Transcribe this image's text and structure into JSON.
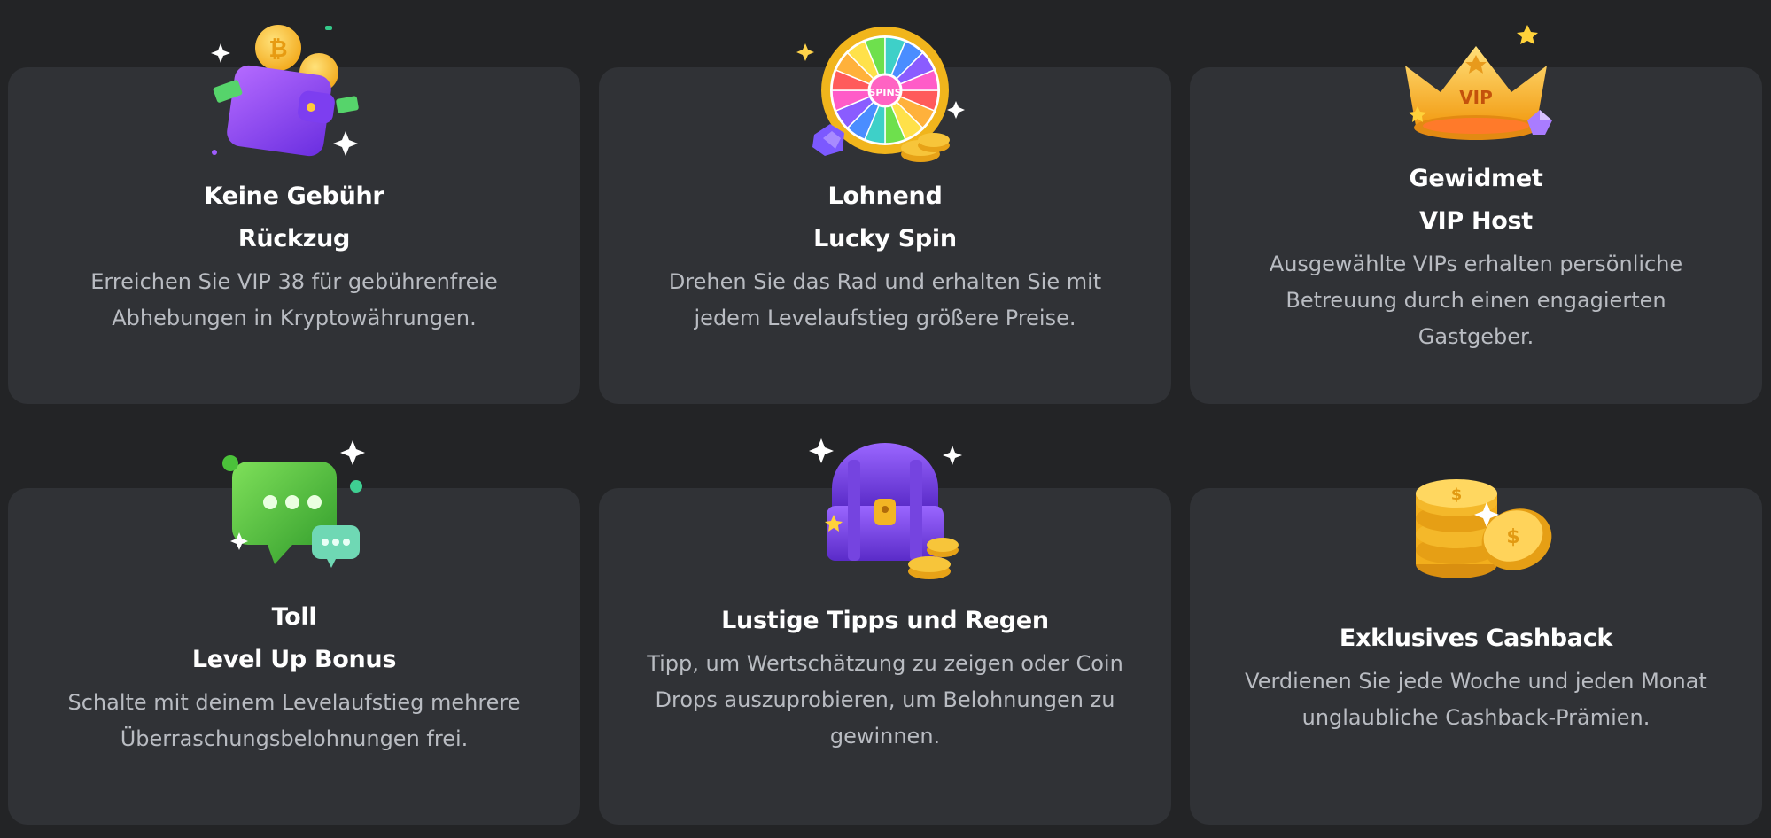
{
  "colors": {
    "background": "#232426",
    "card": "#303236",
    "title": "#ffffff",
    "description": "#b9bcc2",
    "accent_gold": "#f4b619",
    "accent_purple": "#8a4dff",
    "accent_green": "#4cc43a"
  },
  "cards": [
    {
      "icon": "wallet-icon",
      "title_line1": "Keine Gebühr",
      "title_line2": "Rückzug",
      "description_line1": "Erreichen Sie VIP 38 für gebührenfreie",
      "description_line2": "Abhebungen in Kryptowährungen.",
      "description_line3": ""
    },
    {
      "icon": "spin-wheel-icon",
      "icon_label": "SPINS",
      "title_line1": "Lohnend",
      "title_line2": "Lucky Spin",
      "description_line1": "Drehen Sie das Rad und erhalten Sie mit",
      "description_line2": "jedem Levelaufstieg größere Preise.",
      "description_line3": ""
    },
    {
      "icon": "vip-crown-icon",
      "icon_label": "VIP",
      "title_line1": "Gewidmet",
      "title_line2": "VIP Host",
      "description_line1": "Ausgewählte VIPs erhalten persönliche",
      "description_line2": "Betreuung durch einen engagierten",
      "description_line3": "Gastgeber."
    },
    {
      "icon": "chat-bubble-icon",
      "title_line1": "Toll",
      "title_line2": "Level Up Bonus",
      "description_line1": "Schalte mit deinem Levelaufstieg mehrere",
      "description_line2": "Überraschungsbelohnungen frei.",
      "description_line3": ""
    },
    {
      "icon": "treasure-chest-icon",
      "title_line1": "Lustige Tipps und Regen",
      "title_line2": "",
      "description_line1": "Tipp, um Wertschätzung zu zeigen oder Coin",
      "description_line2": "Drops auszuprobieren, um Belohnungen zu",
      "description_line3": "gewinnen."
    },
    {
      "icon": "coin-stack-icon",
      "title_line1": "Exklusives Cashback",
      "title_line2": "",
      "description_line1": "Verdienen Sie jede Woche und jeden Monat",
      "description_line2": "unglaubliche Cashback-Prämien.",
      "description_line3": ""
    }
  ]
}
